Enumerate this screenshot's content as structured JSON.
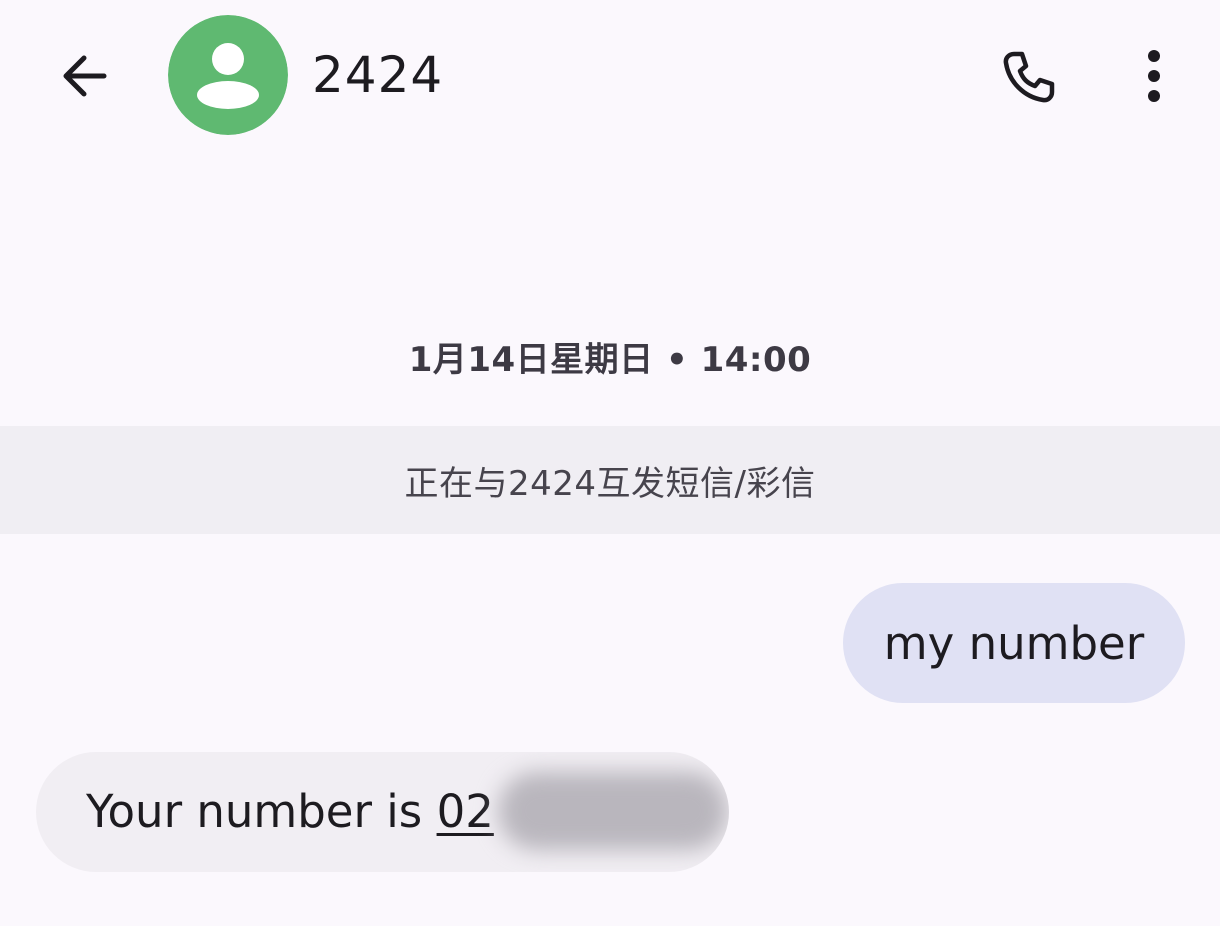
{
  "header": {
    "contact_name": "2424",
    "back_icon": "arrow-back-icon",
    "avatar_icon": "person-icon",
    "avatar_color": "#5fb971",
    "call_icon": "phone-icon",
    "more_icon": "more-vert-icon"
  },
  "conversation": {
    "timestamp": "1月14日星期日 • 14:00",
    "info_banner": "正在与2424互发短信/彩信",
    "messages": [
      {
        "direction": "outgoing",
        "text": "my number"
      },
      {
        "direction": "incoming",
        "text_prefix": "Your number is ",
        "link_visible_text": "02"
      }
    ]
  },
  "colors": {
    "background": "#fbf8fd",
    "outgoing_bubble": "#e0e1f4",
    "incoming_bubble": "#f1eef3",
    "banner_background": "#f0eef3"
  }
}
